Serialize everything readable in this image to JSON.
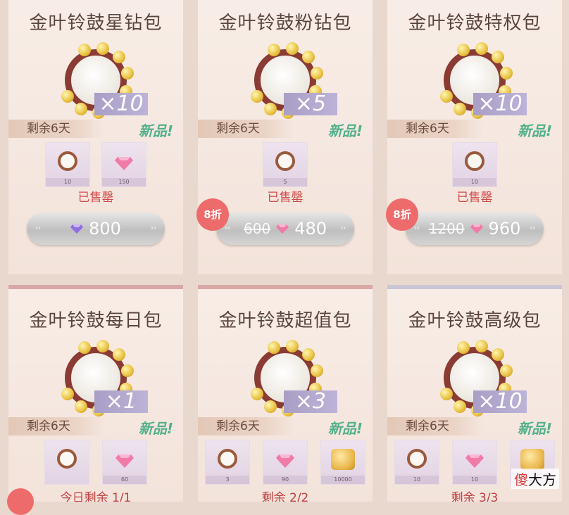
{
  "cards": [
    {
      "title": "金叶铃鼓星钻包",
      "qty": "×10",
      "days": "剩余6天",
      "new": "新品!",
      "status": "已售罄",
      "items": [
        {
          "type": "tambourine",
          "count": "10"
        },
        {
          "type": "diamond",
          "count": "150"
        }
      ],
      "price": "800",
      "old_price": ""
    },
    {
      "title": "金叶铃鼓粉钻包",
      "qty": "×5",
      "days": "剩余6天",
      "new": "新品!",
      "status": "已售罄",
      "items": [
        {
          "type": "tambourine",
          "count": "5"
        }
      ],
      "price": "480",
      "old_price": "600",
      "discount": "8折"
    },
    {
      "title": "金叶铃鼓特权包",
      "qty": "×10",
      "days": "剩余6天",
      "new": "新品!",
      "status": "已售罄",
      "items": [
        {
          "type": "tambourine",
          "count": "10"
        }
      ],
      "price": "960",
      "old_price": "1200",
      "discount": "8折"
    },
    {
      "title": "金叶铃鼓每日包",
      "qty": "×1",
      "days": "剩余6天",
      "new": "新品!",
      "status": "今日剩余 1/1",
      "items": [
        {
          "type": "tambourine",
          "count": ""
        },
        {
          "type": "diamond",
          "count": "60"
        }
      ]
    },
    {
      "title": "金叶铃鼓超值包",
      "qty": "×3",
      "days": "剩余6天",
      "new": "新品!",
      "status": "剩余 2/2",
      "items": [
        {
          "type": "tambourine",
          "count": "3"
        },
        {
          "type": "diamond",
          "count": "90"
        },
        {
          "type": "gold",
          "count": "10000"
        }
      ]
    },
    {
      "title": "金叶铃鼓高级包",
      "qty": "×10",
      "days": "剩余6天",
      "new": "新品!",
      "status": "剩余 3/3",
      "items": [
        {
          "type": "tambourine",
          "count": "10"
        },
        {
          "type": "diamond",
          "count": "10"
        },
        {
          "type": "gold",
          "count": ""
        }
      ]
    }
  ],
  "watermark": {
    "red": "傻",
    "black": "大方"
  },
  "colors": {
    "accent_red": "#d24a4a",
    "new_green": "#52b08a",
    "qty_purple": "#a99fc6",
    "ring": "#8a3b33"
  }
}
